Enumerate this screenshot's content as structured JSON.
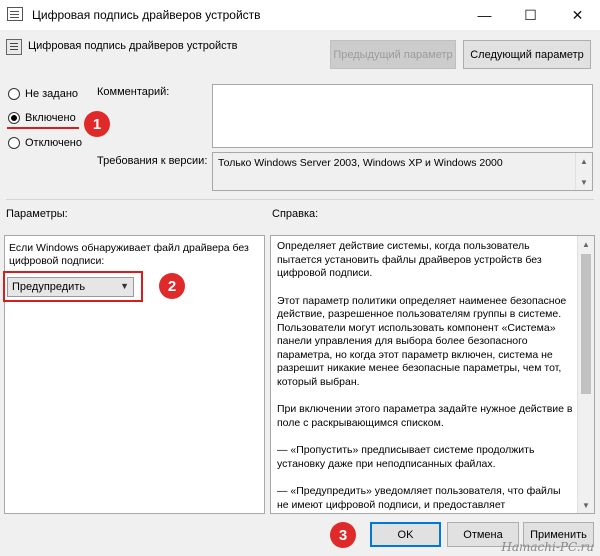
{
  "window": {
    "title": "Цифровая подпись драйверов устройств",
    "minimize_glyph": "—",
    "maximize_glyph": "☐",
    "close_glyph": "✕"
  },
  "header": {
    "policy_title": "Цифровая подпись драйверов устройств",
    "prev_button": "Предыдущий параметр",
    "next_button": "Следующий параметр"
  },
  "state": {
    "options": [
      {
        "label": "Не задано",
        "selected": false
      },
      {
        "label": "Включено",
        "selected": true
      },
      {
        "label": "Отключено",
        "selected": false
      }
    ]
  },
  "comment": {
    "label": "Комментарий:",
    "value": ""
  },
  "requirements": {
    "label": "Требования к версии:",
    "value": "Только Windows Server 2003, Windows XP и Windows 2000"
  },
  "sections": {
    "params_label": "Параметры:",
    "help_label": "Справка:"
  },
  "params": {
    "prompt": "Если Windows обнаруживает файл драйвера без цифровой подписи:",
    "dropdown_value": "Предупредить"
  },
  "help": {
    "paragraphs": [
      "Определяет действие системы, когда пользователь пытается установить файлы драйверов устройств без цифровой подписи.",
      "Этот параметр политики определяет наименее безопасное действие, разрешенное пользователям группы в системе. Пользователи могут использовать компонент «Система» панели управления для выбора более безопасного параметра, но когда этот параметр включен, система не разрешит никакие менее безопасные параметры, чем тот, который выбран.",
      "При включении этого параметра задайте нужное действие в поле с раскрывающимся списком.",
      "— «Пропустить» предписывает системе продолжить установку даже при неподписанных файлах.",
      "— «Предупредить» уведомляет пользователя, что файлы не имеют цифровой подписи, и предоставляет пользователю"
    ]
  },
  "buttons": {
    "ok": "OK",
    "cancel": "Отмена",
    "apply": "Применить"
  },
  "badges": {
    "one": "1",
    "two": "2",
    "three": "3"
  },
  "watermark": "Hamachi-PC.ru",
  "colors": {
    "accent_red": "#d81d1d",
    "focus_blue": "#0078d7"
  }
}
